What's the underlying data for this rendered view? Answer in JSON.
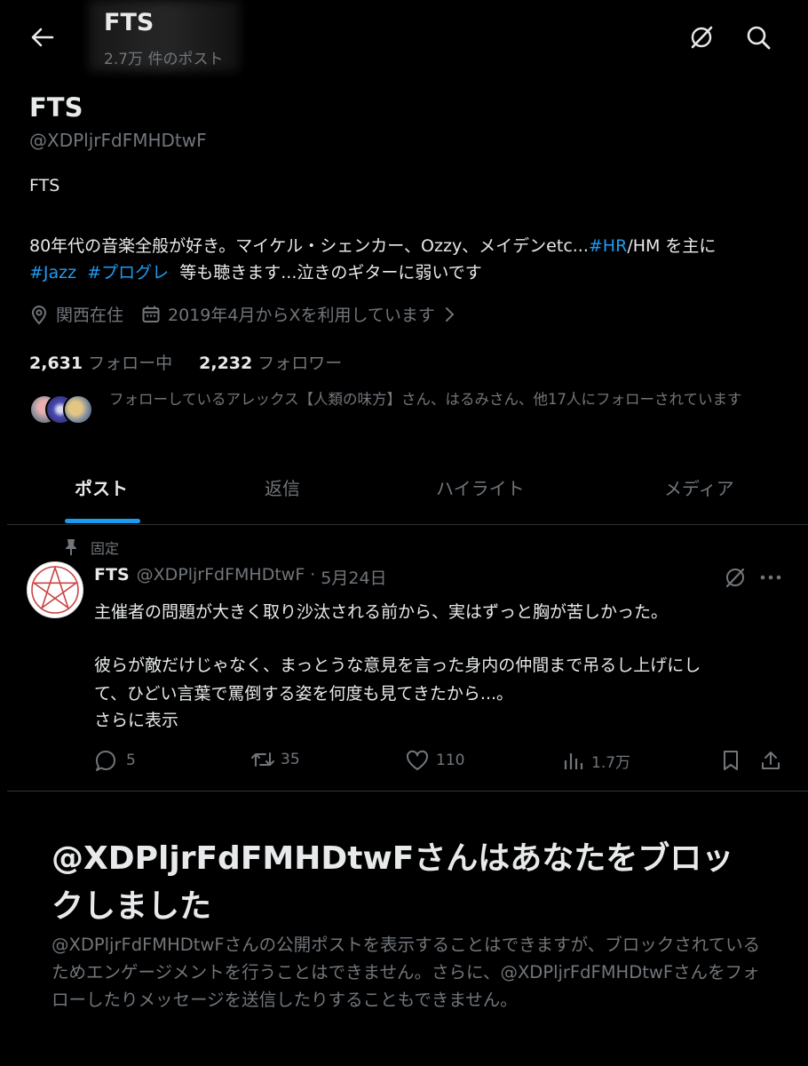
{
  "header": {
    "title": "FTS",
    "post_count": "2.7万 件のポスト"
  },
  "profile": {
    "display_name": "FTS",
    "handle": "@XDPljrFdFMHDtwF",
    "bio_line1": "FTS",
    "bio_line2_pre": "80年代の音楽全般が好き。マイケル・シェンカー、Ozzy、メイデンetc...",
    "bio_line2_tag": "#HR",
    "bio_line2_post": "/HM を主に",
    "bio_line3_tag1": "#Jazz",
    "bio_line3_tag2": "#プログレ",
    "bio_line3_post": "等も聴きます...泣きのギターに弱いです",
    "location": "関西在住",
    "joined": "2019年4月からXを利用しています",
    "following_count": "2,631",
    "following_label": "フォロー中",
    "followers_count": "2,232",
    "followers_label": "フォロワー",
    "known_followers": "フォローしているアレックス【人類の味方】さん、はるみさん、他17人にフォローされています"
  },
  "tabs": [
    {
      "label": "ポスト"
    },
    {
      "label": "返信"
    },
    {
      "label": "ハイライト"
    },
    {
      "label": "メディア"
    }
  ],
  "pinned_post": {
    "pinned_label": "固定",
    "author": "FTS",
    "handle": "@XDPljrFdFMHDtwF",
    "sep": "·",
    "date": "5月24日",
    "text_line1": "主催者の問題が大きく取り沙汰される前から、実はずっと胸が苦しかった。",
    "text_line2": "彼らが敵だけじゃなく、まっとうな意見を言った身内の仲間まで吊るし上げにし",
    "text_line3": "て、ひどい言葉で罵倒する姿を何度も見てきたから...。",
    "show_more": "さらに表示",
    "replies": "5",
    "reposts": "35",
    "likes": "110",
    "views": "1.7万"
  },
  "blocked": {
    "title": "@XDPljrFdFMHDtwFさんはあなたをブロックしました",
    "body": "@XDPljrFdFMHDtwFさんの公開ポストを表示することはできますが、ブロックされているためエンゲージメントを行うことはできません。さらに、@XDPljrFdFMHDtwFさんをフォローしたりメッセージを送信したりすることもできません。"
  },
  "colors": {
    "background": "#000000",
    "text": "#e7e9ea",
    "muted": "#71767b",
    "accent": "#1d9bf0",
    "divider": "#2f3336"
  },
  "icons": [
    "back-arrow-icon",
    "grok-icon",
    "search-icon",
    "location-pin-icon",
    "calendar-icon",
    "chevron-right-icon",
    "pin-icon",
    "more-icon",
    "reply-icon",
    "repost-icon",
    "like-icon",
    "views-icon",
    "bookmark-icon",
    "share-icon"
  ]
}
